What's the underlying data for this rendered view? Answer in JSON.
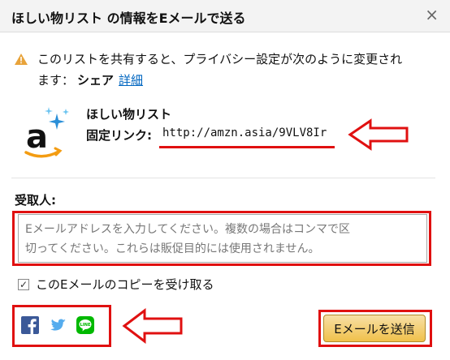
{
  "dialog": {
    "title": "ほしい物リスト の情報をEメールで送る",
    "close_glyph": "×"
  },
  "privacy_notice": {
    "line1": "このリストを共有すると、プライバシー設定が次のように変更され",
    "line2_prefix": "ます：",
    "setting_value": "シェア",
    "details_link": "詳細"
  },
  "list": {
    "name": "ほしい物リスト",
    "permalink_label": "固定リンク:",
    "permalink_url": "http://amzn.asia/9VLV8Ir",
    "logo_icon": "amazon-logo-icon"
  },
  "recipient": {
    "label": "受取人:",
    "placeholder_line1": "Eメールアドレスを入力してください。複数の場合はコンマで区",
    "placeholder_line2": "切ってください。これらは販促目的には使用されません。"
  },
  "copy_option": {
    "label": "このEメールのコピーを受け取る",
    "checked": true
  },
  "share_icons": [
    "facebook-icon",
    "twitter-icon",
    "line-icon"
  ],
  "send_button": {
    "label": "Eメールを送信"
  },
  "colors": {
    "accent_link": "#0066c0",
    "button_fill": "#f0c14b",
    "annotation": "#e01010",
    "facebook": "#3b5998",
    "twitter": "#55acee",
    "line": "#00b900"
  }
}
